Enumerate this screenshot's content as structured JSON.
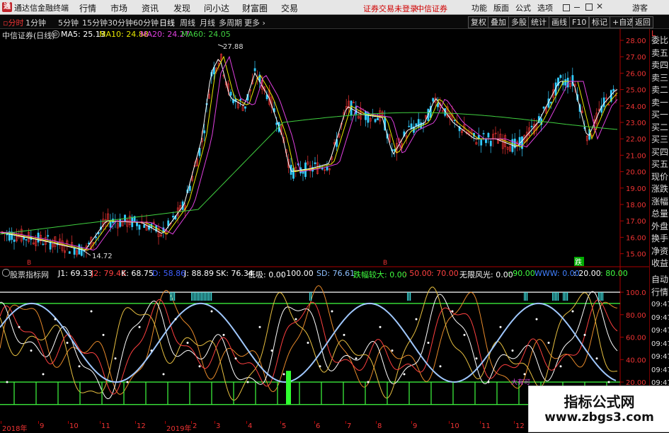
{
  "titlebar": {
    "logo": "通",
    "app_title": "通达信金融终端",
    "menus": [
      "行情",
      "市场",
      "资讯",
      "发现",
      "问小达",
      "财富圈",
      "交易"
    ],
    "status_red": [
      "证券交易未登录",
      "中信证券"
    ],
    "right_menus": [
      "功能",
      "版面",
      "公式",
      "选项",
      "游客"
    ]
  },
  "toolbar": {
    "periods": [
      "分时",
      "1分钟",
      "5分钟",
      "15分钟",
      "30分钟",
      "60分钟",
      "日线",
      "周线",
      "月线",
      "多周期",
      "更多"
    ],
    "active_period": "日线",
    "buttons": [
      "复权",
      "叠加",
      "多股",
      "统计",
      "画线",
      "F10",
      "标记",
      "+自选",
      "返回"
    ]
  },
  "main_chart": {
    "stock": "中信证券(日线)",
    "ma": [
      {
        "label": "MA5: 25.13",
        "color": "#ffffff"
      },
      {
        "label": "MA10: 24.88",
        "color": "#e8e800"
      },
      {
        "label": "MA20: 24.27",
        "color": "#e040e0"
      },
      {
        "label": "MA60: 24.05",
        "color": "#40d040"
      }
    ],
    "high_label": "27.88",
    "low_label": "14.72",
    "price_ticks": [
      "28.00",
      "27.00",
      "26.00",
      "25.00",
      "24.00",
      "23.00",
      "22.00",
      "21.00",
      "20.00",
      "19.00",
      "18.00",
      "17.00",
      "16.00",
      "15.00"
    ],
    "markers": [
      "B",
      "B",
      "跌"
    ]
  },
  "indicator": {
    "name": "股票指标网",
    "values": [
      {
        "label": "J1: 69.33",
        "color": "#ffffff"
      },
      {
        "label": "J2: 79.46",
        "color": "#ff4040"
      },
      {
        "label": "K: 68.75",
        "color": "#ffffff"
      },
      {
        "label": "D: 58.86",
        "color": "#4060ff"
      },
      {
        "label": "J: 88.89",
        "color": "#ffffff"
      },
      {
        "label": "SK: 76.34",
        "color": "#ffffff"
      },
      {
        "label": "低吸: 0.00",
        "color": "#ffffff"
      },
      {
        "label": ": 100.00",
        "color": "#ffffff"
      },
      {
        "label": "SD: 76.61",
        "color": "#8ec0ff"
      },
      {
        "label": "跌幅较大: 0.00",
        "color": "#40ff40"
      },
      {
        "label": ": 50.00",
        "color": "#ff4040"
      },
      {
        "label": ": 70.00",
        "color": "#ff4040"
      },
      {
        "label": "无限风光: 0.00",
        "color": "#ffffff"
      },
      {
        "label": ": 90.00",
        "color": "#40ff40"
      },
      {
        "label": "WWW: 0.00",
        "color": "#4080ff"
      },
      {
        "label": ": 20.00",
        "color": "#ffffff"
      },
      {
        "label": ": 80.00",
        "color": "#40ff40"
      }
    ],
    "ticks": [
      "100.0",
      "80.00",
      "60.00",
      "40.00",
      "20.00"
    ],
    "cut_label": "大有可"
  },
  "right_panel": {
    "items": [
      "委比",
      "卖五",
      "卖四",
      "卖三",
      "卖二",
      "卖一",
      "买一",
      "买二",
      "买三",
      "买四",
      "买五",
      "现价",
      "涨跌",
      "涨幅",
      "总量",
      "外盘",
      "换手",
      "净资",
      "收益"
    ],
    "lower_items": [
      "自动",
      "行情",
      "09:47",
      "09:47",
      "09:47",
      "09:47",
      "09:47",
      "09:47",
      "09:47",
      "09:47"
    ]
  },
  "time_axis": [
    "2018年",
    "9",
    "10",
    "11",
    "12",
    "2019年",
    "2",
    "3",
    "4",
    "5",
    "6",
    "7",
    "8",
    "9",
    "10",
    "11",
    "12"
  ],
  "watermark": {
    "line1": "指标公式网",
    "line2": "www.zbgs3.com"
  }
}
